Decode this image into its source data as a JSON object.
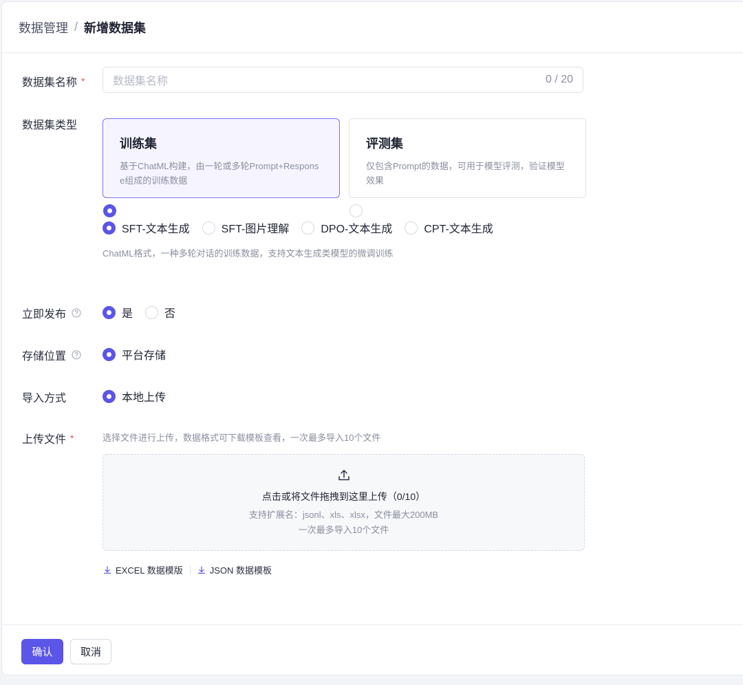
{
  "breadcrumb": {
    "parent": "数据管理",
    "separator": "/",
    "current": "新增数据集"
  },
  "name_field": {
    "label": "数据集名称",
    "required_mark": "*",
    "placeholder": "数据集名称",
    "counter": "0 / 20"
  },
  "type_field": {
    "label": "数据集类型",
    "cards": [
      {
        "title": "训练集",
        "desc": "基于ChatML构建，由一轮或多轮Prompt+Response组成的训练数据",
        "selected": true
      },
      {
        "title": "评测集",
        "desc": "仅包含Prompt的数据，可用于模型评测，验证模型效果",
        "selected": false
      }
    ],
    "sub_options": [
      {
        "label": "SFT-文本生成",
        "selected": true
      },
      {
        "label": "SFT-图片理解",
        "selected": false
      },
      {
        "label": "DPO-文本生成",
        "selected": false
      },
      {
        "label": "CPT-文本生成",
        "selected": false
      }
    ],
    "hint": "ChatML格式，一种多轮对话的训练数据，支持文本生成类模型的微调训练"
  },
  "publish_field": {
    "label": "立即发布",
    "options": [
      {
        "label": "是",
        "selected": true
      },
      {
        "label": "否",
        "selected": false
      }
    ]
  },
  "storage_field": {
    "label": "存储位置",
    "option": "平台存储"
  },
  "import_field": {
    "label": "导入方式",
    "option": "本地上传"
  },
  "upload_field": {
    "label": "上传文件",
    "required_mark": "*",
    "hint": "选择文件进行上传，数据格式可下载模板查看，一次最多导入10个文件",
    "drop_title": "点击或将文件拖拽到这里上传（0/10）",
    "drop_sub1": "支持扩展名：jsonl、xls、xlsx，文件最大200MB",
    "drop_sub2": "一次最多导入10个文件",
    "templates": [
      "EXCEL 数据模版",
      "JSON 数据模板"
    ]
  },
  "footer": {
    "confirm": "确认",
    "cancel": "取消"
  },
  "colors": {
    "primary": "#5b55e8",
    "required": "#f0525e",
    "card_active_bg": "#f6f5ff"
  }
}
